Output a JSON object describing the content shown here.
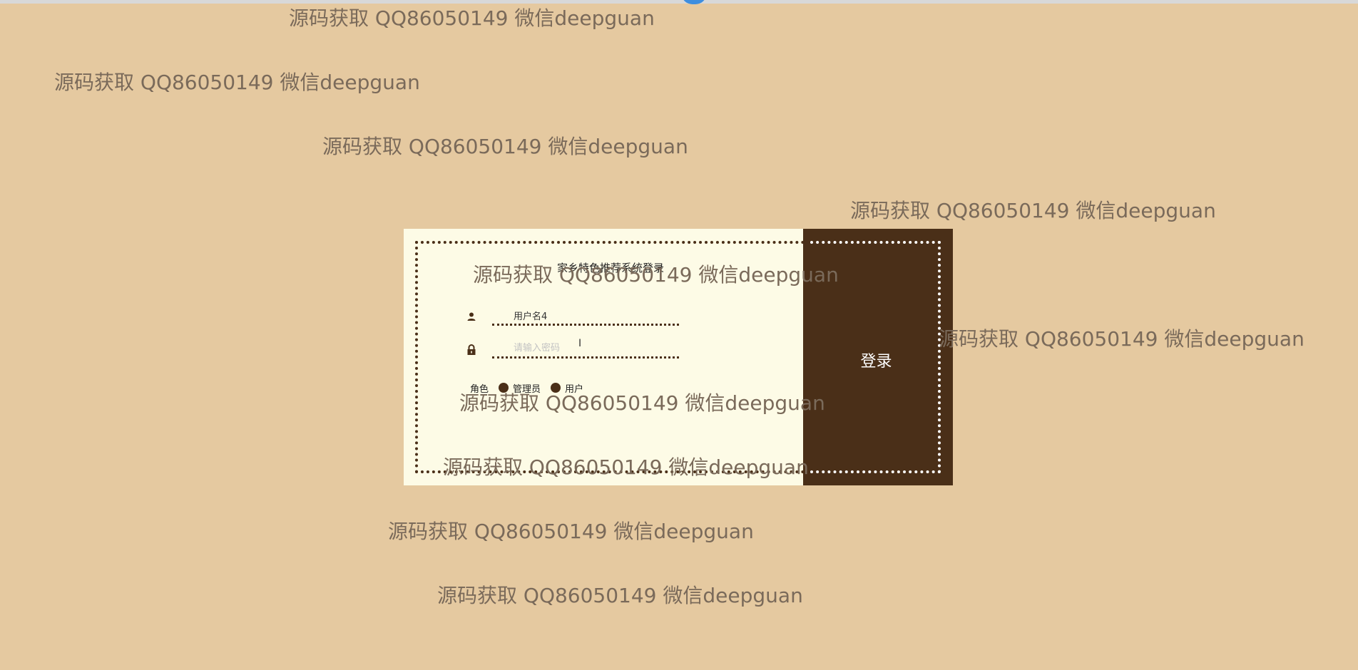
{
  "login_form": {
    "title": "家乡特色推荐系统登录",
    "username_value": "用户名4",
    "password_placeholder": "请输入密码",
    "role_label": "角色",
    "role_options": [
      "管理员",
      "用户"
    ],
    "submit_label": "登录"
  },
  "watermarks": [
    "源码获取 QQ86050149 微信deepguan",
    "源码获取 QQ86050149 微信deepguan",
    "源码获取 QQ86050149 微信deepguan",
    "源码获取 QQ86050149 微信deepguan",
    "源码获取 QQ86050149 微信deepguan",
    "源码获取 QQ86050149 微信deepguan",
    "源码获取 QQ86050149 微信deepguan",
    "源码获取 QQ86050149 微信deepguan",
    "源码获取 QQ86050149 微信deepguan",
    "源码获取 QQ86050149 微信deepguan"
  ],
  "colors": {
    "background": "#e5c9a0",
    "card": "#fdfbe6",
    "accent": "#4a2f18"
  }
}
